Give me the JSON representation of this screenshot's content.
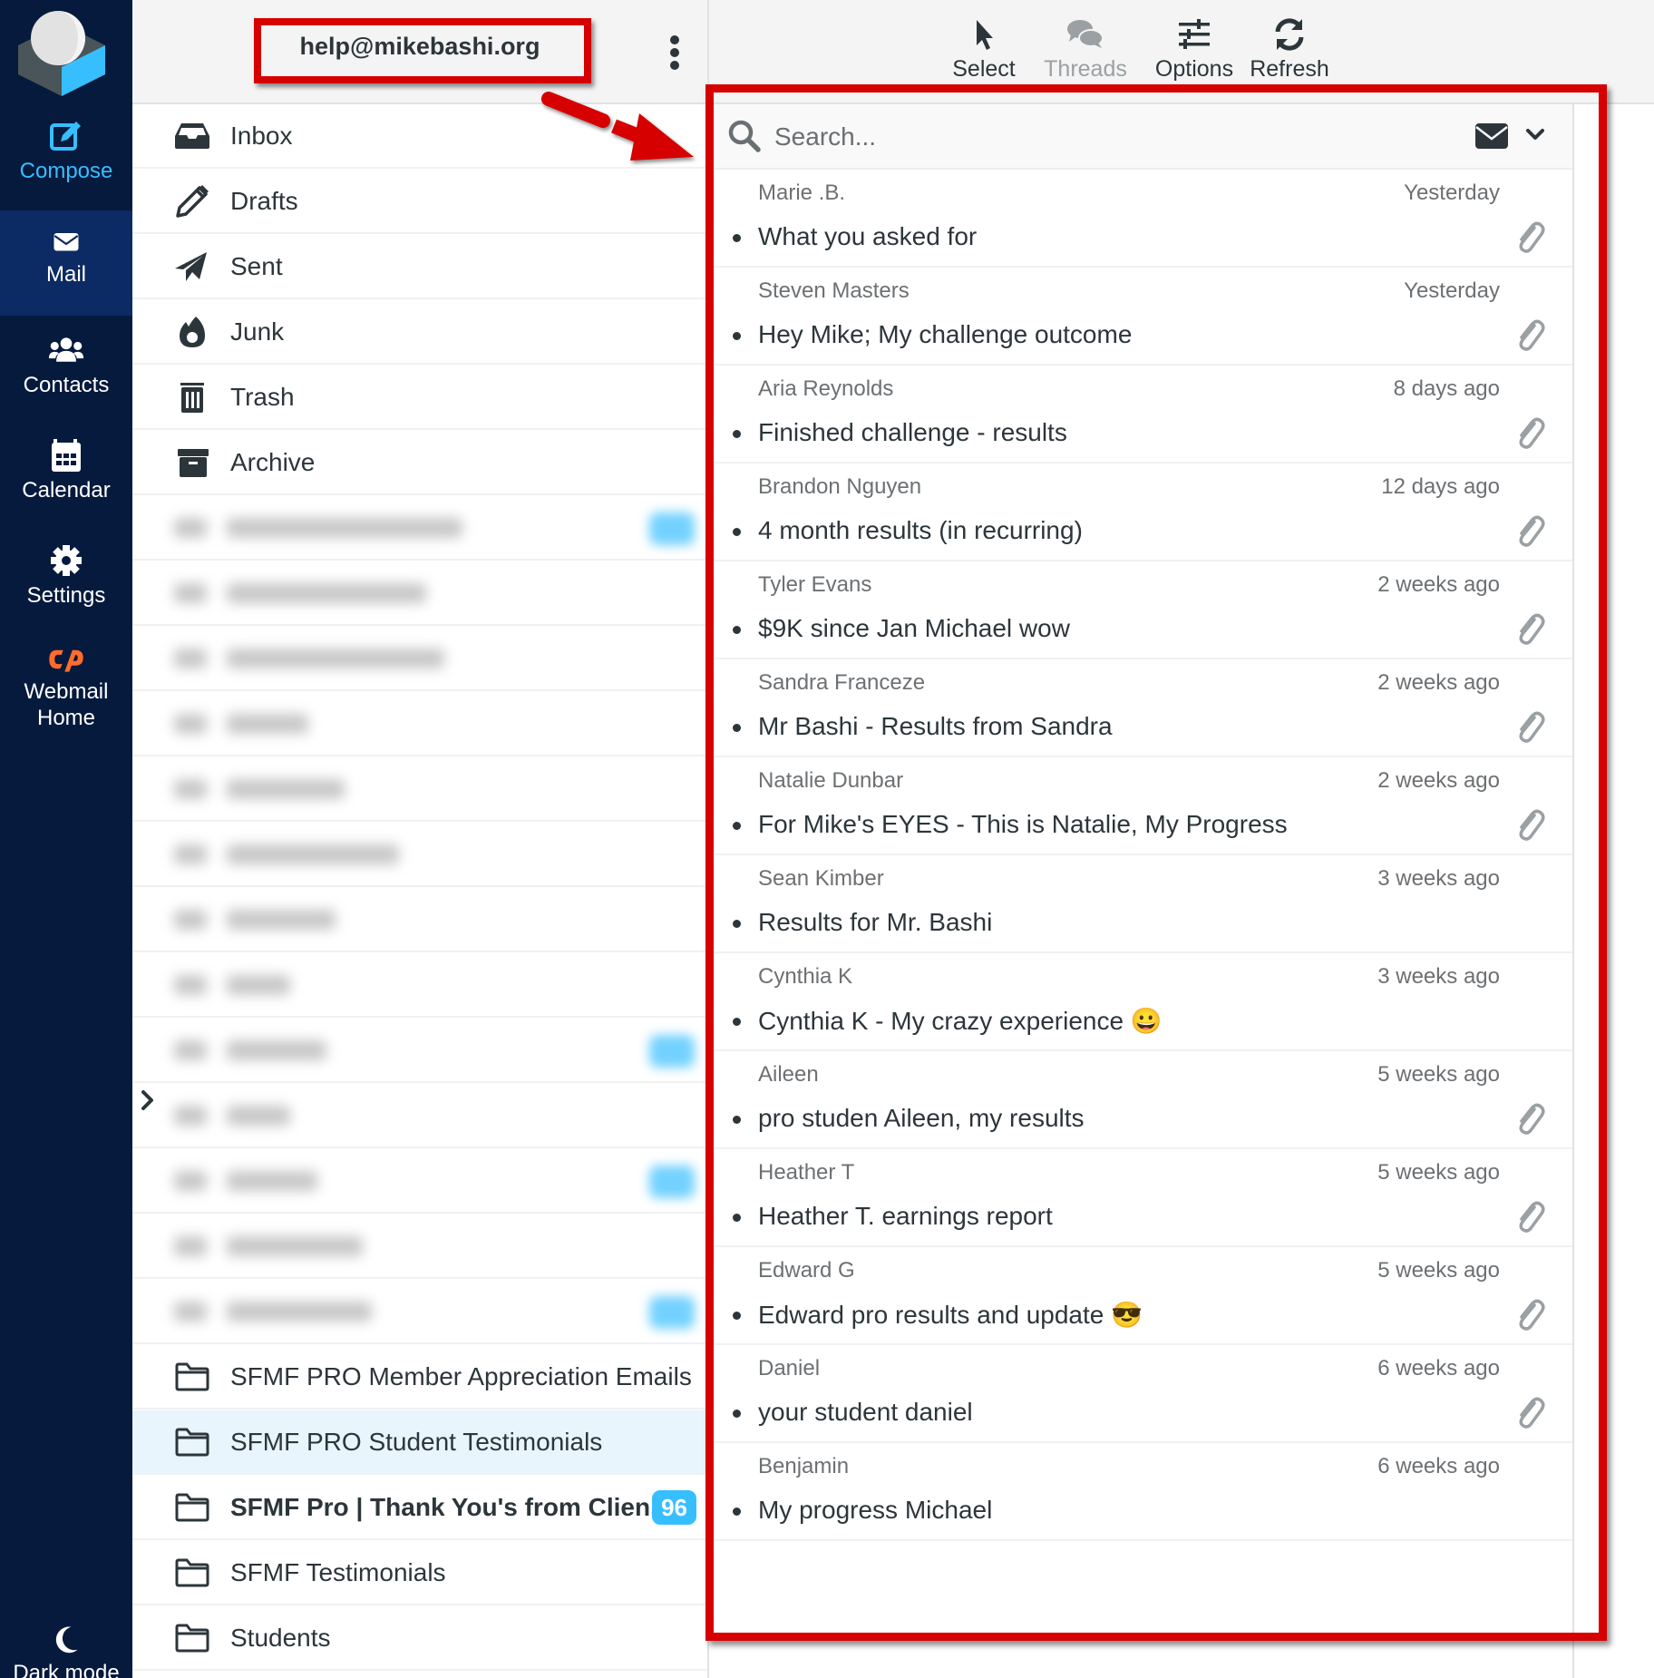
{
  "nav": {
    "compose": "Compose",
    "mail": "Mail",
    "contacts": "Contacts",
    "calendar": "Calendar",
    "settings": "Settings",
    "webmail_home_line1": "Webmail",
    "webmail_home_line2": "Home",
    "dark_mode": "Dark mode"
  },
  "account": {
    "email": "help@mikebashi.org"
  },
  "folders": {
    "system": [
      {
        "label": "Inbox",
        "icon": "inbox-icon"
      },
      {
        "label": "Drafts",
        "icon": "pencil-icon"
      },
      {
        "label": "Sent",
        "icon": "paper-plane-icon"
      },
      {
        "label": "Junk",
        "icon": "fire-icon"
      },
      {
        "label": "Trash",
        "icon": "trash-icon"
      },
      {
        "label": "Archive",
        "icon": "archive-icon"
      }
    ],
    "custom": [
      {
        "label": "SFMF PRO Member Appreciation Emails"
      },
      {
        "label": "SFMF PRO Student Testimonials",
        "selected": true
      },
      {
        "label": "SFMF Pro | Thank You's from Clien...",
        "unread": "96"
      },
      {
        "label": "SFMF Testimonials"
      },
      {
        "label": "Students"
      }
    ]
  },
  "toolbar": {
    "select": "Select",
    "threads": "Threads",
    "options": "Options",
    "refresh": "Refresh"
  },
  "search": {
    "placeholder": "Search..."
  },
  "messages": [
    {
      "from": "Marie .B.",
      "date": "Yesterday",
      "subject": "What you asked for",
      "attachment": true
    },
    {
      "from": "Steven Masters",
      "date": "Yesterday",
      "subject": "Hey Mike; My challenge outcome",
      "attachment": true
    },
    {
      "from": "Aria Reynolds",
      "date": "8 days ago",
      "subject": "Finished challenge - results",
      "attachment": true
    },
    {
      "from": "Brandon Nguyen",
      "date": "12 days ago",
      "subject": "4 month results (in recurring)",
      "attachment": true
    },
    {
      "from": "Tyler Evans",
      "date": "2 weeks ago",
      "subject": "$9K since Jan Michael wow",
      "attachment": true
    },
    {
      "from": "Sandra Franceze",
      "date": "2 weeks ago",
      "subject": "Mr Bashi - Results from Sandra",
      "attachment": true
    },
    {
      "from": "Natalie Dunbar",
      "date": "2 weeks ago",
      "subject": "For Mike's EYES - This is Natalie, My Progress",
      "attachment": true
    },
    {
      "from": "Sean Kimber",
      "date": "3 weeks ago",
      "subject": "Results for Mr. Bashi",
      "attachment": false
    },
    {
      "from": "Cynthia K",
      "date": "3 weeks ago",
      "subject": "Cynthia K - My crazy experience 😀",
      "attachment": false
    },
    {
      "from": "Aileen",
      "date": "5 weeks ago",
      "subject": "pro studen Aileen, my results",
      "attachment": true
    },
    {
      "from": "Heather T",
      "date": "5 weeks ago",
      "subject": "Heather T. earnings report",
      "attachment": true
    },
    {
      "from": "Edward G",
      "date": "5 weeks ago",
      "subject": "Edward pro results and update 😎",
      "attachment": true
    },
    {
      "from": "Daniel",
      "date": "6 weeks ago",
      "subject": "your student daniel",
      "attachment": true
    },
    {
      "from": "Benjamin",
      "date": "6 weeks ago",
      "subject": "My progress Michael",
      "attachment": false
    }
  ],
  "colors": {
    "nav_bg": "#061a3d",
    "nav_active": "#0c2a63",
    "accent": "#37beff",
    "annotation_red": "#d60000",
    "cpanel_orange": "#ff6c2c"
  }
}
